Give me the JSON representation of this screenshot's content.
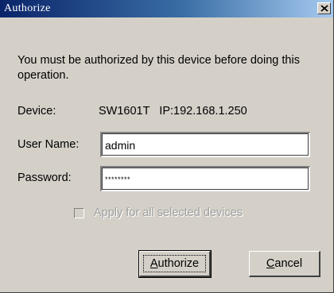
{
  "window": {
    "title": "Authorize",
    "close_glyph": "✕"
  },
  "message": "You must be authorized by this device before doing this operation.",
  "device": {
    "label": "Device:",
    "value": "SW1601T   IP:192.168.1.250"
  },
  "user_name": {
    "label": "User Name:",
    "value": "admin"
  },
  "password": {
    "label": "Password:",
    "value": "********"
  },
  "apply_all": {
    "label": "Apply for all selected devices",
    "checked": false,
    "enabled": false
  },
  "buttons": {
    "authorize_label": "Authorize",
    "cancel_label": "Cancel"
  },
  "colors": {
    "title_gradient_start": "#0a246a",
    "title_gradient_end": "#a6caf0",
    "face": "#d4d0c8"
  }
}
